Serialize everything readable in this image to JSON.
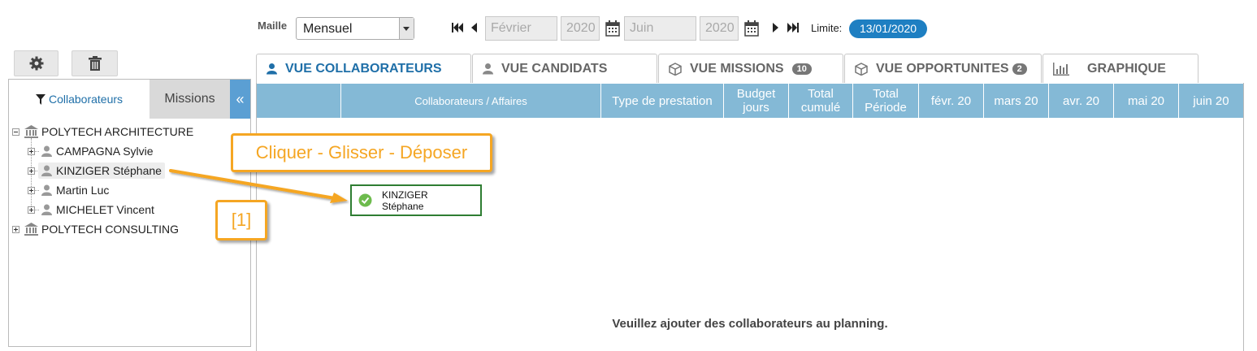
{
  "toolbar": {
    "maille_label": "Maille",
    "maille_value": "Mensuel",
    "start_month": "Février",
    "start_year": "2020",
    "end_month": "Juin",
    "end_year": "2020",
    "limite_label": "Limite:",
    "limite_date": "13/01/2020"
  },
  "left_panel": {
    "tab_collaborateurs": "Collaborateurs",
    "tab_missions": "Missions",
    "collapse_glyph": "«",
    "tree": [
      {
        "label": "POLYTECH ARCHITECTURE",
        "type": "company",
        "expanded": true
      },
      {
        "label": "CAMPAGNA Sylvie",
        "type": "person"
      },
      {
        "label": "KINZIGER Stéphane",
        "type": "person",
        "selected": true
      },
      {
        "label": "Martin Luc",
        "type": "person"
      },
      {
        "label": "MICHELET Vincent",
        "type": "person"
      },
      {
        "label": "POLYTECH CONSULTING",
        "type": "company",
        "expanded": false
      }
    ]
  },
  "tabs": [
    {
      "label": "VUE COLLABORATEURS",
      "icon": "user-icon",
      "active": true
    },
    {
      "label": "VUE CANDIDATS",
      "icon": "user-icon"
    },
    {
      "label": "VUE MISSIONS",
      "icon": "cube-icon",
      "count": "10"
    },
    {
      "label": "VUE OPPORTUNITES",
      "icon": "cube-icon",
      "count": "2"
    },
    {
      "label": "GRAPHIQUE",
      "icon": "bar-chart-icon"
    }
  ],
  "grid": {
    "headers": [
      "Collaborateurs / Affaires",
      "Type de prestation",
      "Budget jours",
      "Total cumulé",
      "Total Période",
      "févr. 20",
      "mars 20",
      "avr. 20",
      "mai 20",
      "juin 20"
    ],
    "empty_message": "Veuillez ajouter des collaborateurs au planning."
  },
  "drag_card": {
    "line1": "KINZIGER",
    "line2": "Stéphane"
  },
  "callouts": {
    "drag_hint": "Cliquer - Glisser - Déposer",
    "step": "[1]"
  },
  "colors": {
    "accent": "#1f6fa8",
    "header_bg": "#84b9d6",
    "callout": "#f5a623",
    "card_border": "#2e7d32",
    "badge": "#1e7fc2"
  }
}
